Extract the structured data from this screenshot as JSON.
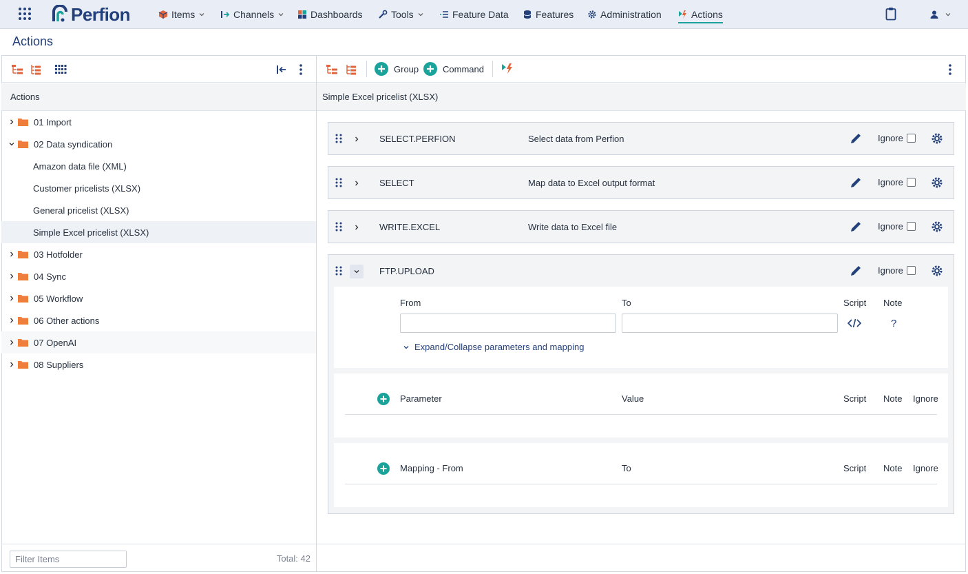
{
  "topnav": {
    "logo": "Perfion",
    "items": [
      {
        "label": "Items"
      },
      {
        "label": "Channels"
      },
      {
        "label": "Dashboards"
      },
      {
        "label": "Tools"
      },
      {
        "label": "Feature Data"
      },
      {
        "label": "Features"
      },
      {
        "label": "Administration"
      },
      {
        "label": "Actions"
      }
    ],
    "active": "Actions"
  },
  "page": {
    "title": "Actions"
  },
  "left": {
    "header": "Actions",
    "tree": [
      {
        "label": "01 Import"
      },
      {
        "label": "02 Data syndication"
      },
      {
        "label": "Amazon data file (XML)"
      },
      {
        "label": "Customer pricelists (XLSX)"
      },
      {
        "label": "General pricelist (XLSX)"
      },
      {
        "label": "Simple Excel pricelist (XLSX)"
      },
      {
        "label": "03 Hotfolder"
      },
      {
        "label": "04 Sync"
      },
      {
        "label": "05 Workflow"
      },
      {
        "label": "06 Other actions"
      },
      {
        "label": "07 OpenAI"
      },
      {
        "label": "08 Suppliers"
      }
    ],
    "filter_placeholder": "Filter Items",
    "total": "Total: 42"
  },
  "right": {
    "toolbar": {
      "group_label": "Group",
      "command_label": "Command"
    },
    "header": "Simple Excel pricelist (XLSX)",
    "commands": [
      {
        "name": "SELECT.PERFION",
        "description": "Select data from Perfion",
        "ignore_label": "Ignore"
      },
      {
        "name": "SELECT",
        "description": "Map data to Excel output format",
        "ignore_label": "Ignore"
      },
      {
        "name": "WRITE.EXCEL",
        "description": "Write data to Excel file",
        "ignore_label": "Ignore"
      },
      {
        "name": "FTP.UPLOAD",
        "description": "",
        "ignore_label": "Ignore"
      }
    ],
    "ftp": {
      "from_label": "From",
      "to_label": "To",
      "script_label": "Script",
      "note_label": "Note",
      "note_icon": "?",
      "expand_link": "Expand/Collapse parameters and mapping",
      "params": {
        "col1": "Parameter",
        "col2": "Value",
        "col3": "Script",
        "col4": "Note",
        "col5": "Ignore"
      },
      "mapping": {
        "col1": "Mapping - From",
        "col2": "To",
        "col3": "Script",
        "col4": "Note",
        "col5": "Ignore"
      }
    }
  },
  "colors": {
    "brand": "#23407a",
    "accent": "#1aa39a",
    "folder": "#ef7d3b",
    "nav_bg": "#e9edf6"
  }
}
